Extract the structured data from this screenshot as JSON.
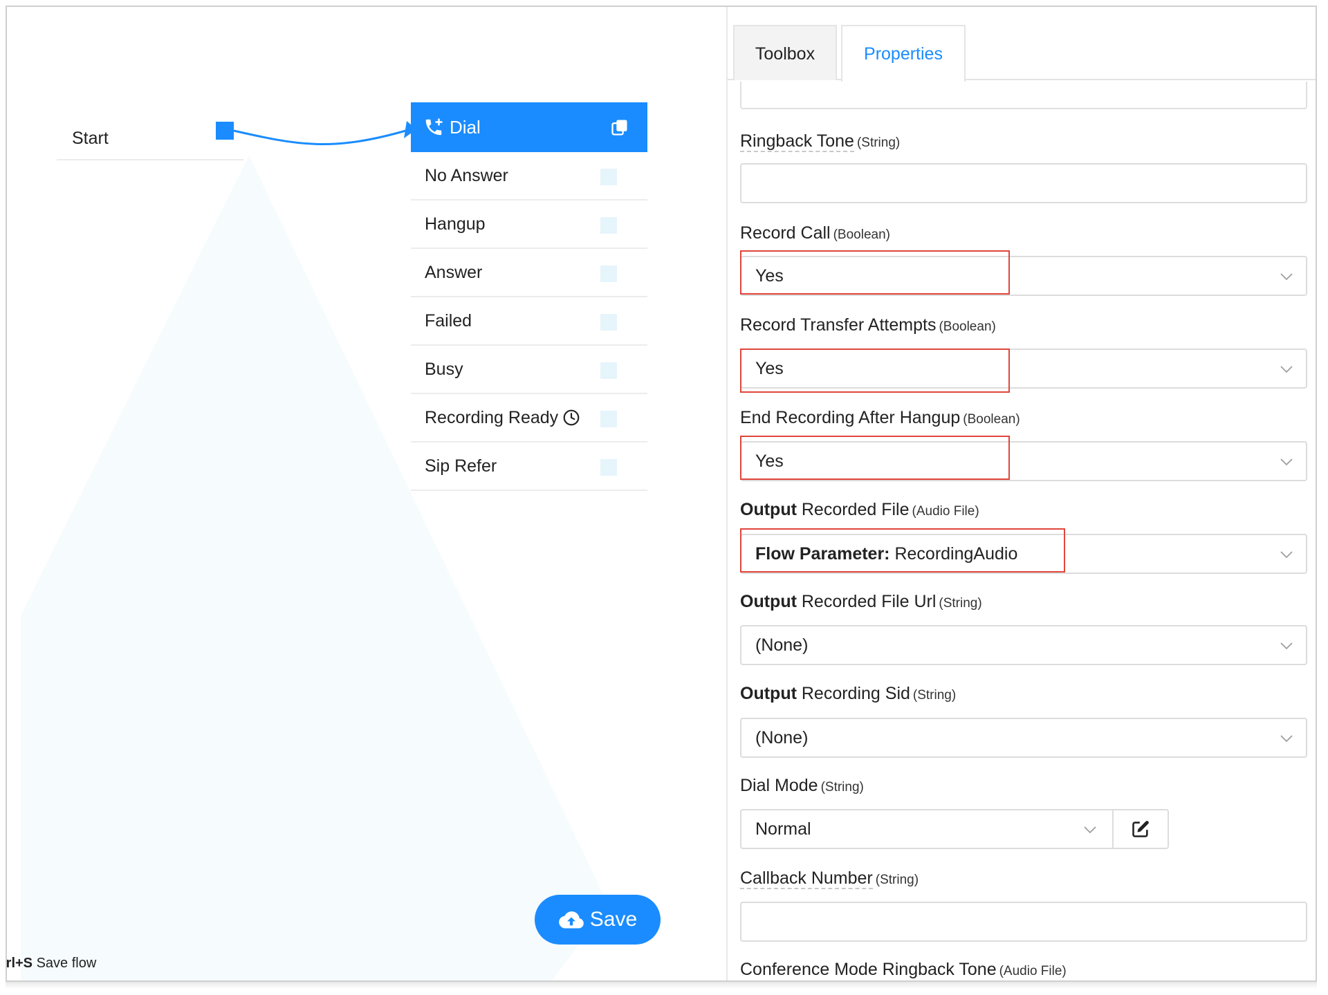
{
  "canvas": {
    "start_label": "Start",
    "dial": {
      "title": "Dial",
      "outputs": [
        "No Answer",
        "Hangup",
        "Answer",
        "Failed",
        "Busy",
        "Recording Ready",
        "Sip Refer"
      ]
    },
    "save_label": "Save",
    "shortcut_key": "trl+S",
    "shortcut_text": "Save flow"
  },
  "tabs": {
    "toolbox": "Toolbox",
    "properties": "Properties"
  },
  "properties": {
    "ringback_tone": {
      "label": "Ringback Tone",
      "type": "(String)",
      "value": ""
    },
    "record_call": {
      "label": "Record Call",
      "type": "(Boolean)",
      "value": "Yes"
    },
    "record_transfer": {
      "label": "Record Transfer Attempts",
      "type": "(Boolean)",
      "value": "Yes"
    },
    "end_recording": {
      "label": "End Recording After Hangup",
      "type": "(Boolean)",
      "value": "Yes"
    },
    "output_file": {
      "label_strong": "Output",
      "label": "Recorded File",
      "type": "(Audio File)",
      "value_strong": "Flow Parameter:",
      "value": "RecordingAudio"
    },
    "output_file_url": {
      "label_strong": "Output",
      "label": "Recorded File Url",
      "type": "(String)",
      "value": "(None)"
    },
    "output_sid": {
      "label_strong": "Output",
      "label": "Recording Sid",
      "type": "(String)",
      "value": "(None)"
    },
    "dial_mode": {
      "label": "Dial Mode",
      "type": "(String)",
      "value": "Normal"
    },
    "callback_number": {
      "label": "Callback Number",
      "type": "(String)",
      "value": ""
    },
    "conference_ringback": {
      "label": "Conference Mode Ringback Tone",
      "type": "(Audio File)"
    }
  },
  "colors": {
    "accent": "#1a8cff",
    "highlight": "#e0453a"
  }
}
